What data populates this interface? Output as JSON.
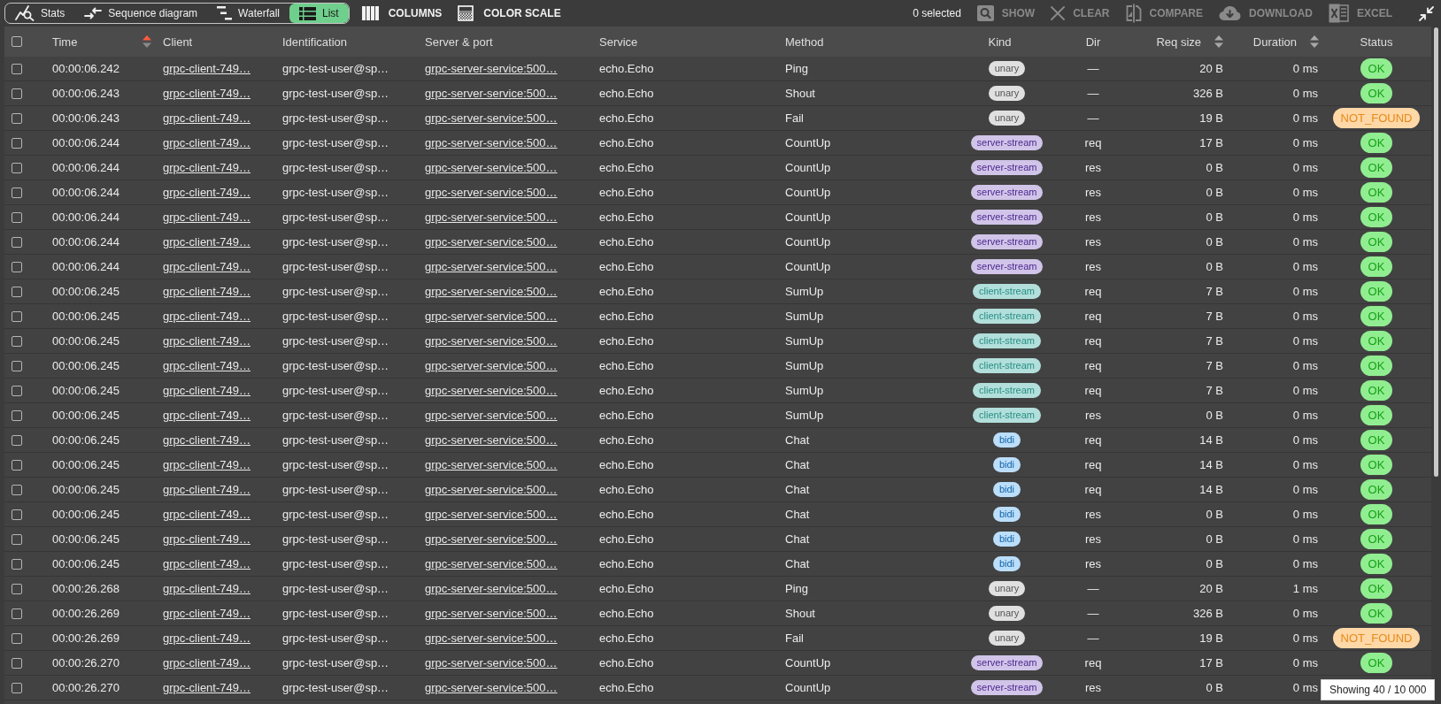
{
  "toolbar": {
    "views": [
      {
        "kind": "stats",
        "label": "Stats",
        "selected": false
      },
      {
        "kind": "sequence",
        "label": "Sequence diagram",
        "selected": false
      },
      {
        "kind": "waterfall",
        "label": "Waterfall",
        "selected": false
      },
      {
        "kind": "list",
        "label": "List",
        "selected": true
      }
    ],
    "tools": [
      {
        "kind": "columns",
        "label": "COLUMNS"
      },
      {
        "kind": "color_scale",
        "label": "COLOR SCALE"
      }
    ],
    "selection": "0 selected",
    "actions": [
      {
        "kind": "show",
        "label": "SHOW",
        "disabled": true
      },
      {
        "kind": "clear",
        "label": "CLEAR",
        "disabled": true
      },
      {
        "kind": "compare",
        "label": "COMPARE",
        "disabled": true
      },
      {
        "kind": "download",
        "label": "DOWNLOAD",
        "disabled": true
      },
      {
        "kind": "excel",
        "label": "EXCEL",
        "disabled": true
      }
    ]
  },
  "table": {
    "select_all": {
      "checked": false
    },
    "columns": [
      {
        "label": "Time",
        "sorted": true
      },
      {
        "label": "Client"
      },
      {
        "label": "Identification"
      },
      {
        "label": "Server & port"
      },
      {
        "label": "Service"
      },
      {
        "label": "Method"
      },
      {
        "label": "Kind"
      },
      {
        "label": "Dir"
      },
      {
        "label": "Req size",
        "sorted": false
      },
      {
        "label": "Duration",
        "sorted": false
      },
      {
        "label": "Status"
      }
    ],
    "rows": [
      {
        "selected": false,
        "time": "00:00:06.242",
        "client": "grpc-client-749…",
        "identification": "grpc-test-user@sp…",
        "server": "grpc-server-service:500…",
        "service": "echo.Echo",
        "method": "Ping",
        "kind": {
          "label": "unary",
          "color": "#e0e0e0"
        },
        "dir": "—",
        "req_size": "20 B",
        "duration": "0 ms",
        "status": {
          "label": "OK",
          "color": "#90ee90"
        }
      },
      {
        "selected": false,
        "time": "00:00:06.243",
        "client": "grpc-client-749…",
        "identification": "grpc-test-user@sp…",
        "server": "grpc-server-service:500…",
        "service": "echo.Echo",
        "method": "Shout",
        "kind": {
          "label": "unary",
          "color": "#e0e0e0"
        },
        "dir": "—",
        "req_size": "326 B",
        "duration": "0 ms",
        "status": {
          "label": "OK",
          "color": "#90ee90"
        }
      },
      {
        "selected": false,
        "time": "00:00:06.243",
        "client": "grpc-client-749…",
        "identification": "grpc-test-user@sp…",
        "server": "grpc-server-service:500…",
        "service": "echo.Echo",
        "method": "Fail",
        "kind": {
          "label": "unary",
          "color": "#e0e0e0"
        },
        "dir": "—",
        "req_size": "19 B",
        "duration": "0 ms",
        "status": {
          "label": "NOT_FOUND",
          "color": "#ffd8a8"
        }
      },
      {
        "selected": false,
        "time": "00:00:06.244",
        "client": "grpc-client-749…",
        "identification": "grpc-test-user@sp…",
        "server": "grpc-server-service:500…",
        "service": "echo.Echo",
        "method": "CountUp",
        "kind": {
          "label": "server-stream",
          "color": "#d1c4e9"
        },
        "dir": "req",
        "req_size": "17 B",
        "duration": "0 ms",
        "status": {
          "label": "OK",
          "color": "#90ee90"
        }
      },
      {
        "selected": false,
        "time": "00:00:06.244",
        "client": "grpc-client-749…",
        "identification": "grpc-test-user@sp…",
        "server": "grpc-server-service:500…",
        "service": "echo.Echo",
        "method": "CountUp",
        "kind": {
          "label": "server-stream",
          "color": "#d1c4e9"
        },
        "dir": "res",
        "req_size": "0 B",
        "duration": "0 ms",
        "status": {
          "label": "OK",
          "color": "#90ee90"
        }
      },
      {
        "selected": false,
        "time": "00:00:06.244",
        "client": "grpc-client-749…",
        "identification": "grpc-test-user@sp…",
        "server": "grpc-server-service:500…",
        "service": "echo.Echo",
        "method": "CountUp",
        "kind": {
          "label": "server-stream",
          "color": "#d1c4e9"
        },
        "dir": "res",
        "req_size": "0 B",
        "duration": "0 ms",
        "status": {
          "label": "OK",
          "color": "#90ee90"
        }
      },
      {
        "selected": false,
        "time": "00:00:06.244",
        "client": "grpc-client-749…",
        "identification": "grpc-test-user@sp…",
        "server": "grpc-server-service:500…",
        "service": "echo.Echo",
        "method": "CountUp",
        "kind": {
          "label": "server-stream",
          "color": "#d1c4e9"
        },
        "dir": "res",
        "req_size": "0 B",
        "duration": "0 ms",
        "status": {
          "label": "OK",
          "color": "#90ee90"
        }
      },
      {
        "selected": false,
        "time": "00:00:06.244",
        "client": "grpc-client-749…",
        "identification": "grpc-test-user@sp…",
        "server": "grpc-server-service:500…",
        "service": "echo.Echo",
        "method": "CountUp",
        "kind": {
          "label": "server-stream",
          "color": "#d1c4e9"
        },
        "dir": "res",
        "req_size": "0 B",
        "duration": "0 ms",
        "status": {
          "label": "OK",
          "color": "#90ee90"
        }
      },
      {
        "selected": false,
        "time": "00:00:06.244",
        "client": "grpc-client-749…",
        "identification": "grpc-test-user@sp…",
        "server": "grpc-server-service:500…",
        "service": "echo.Echo",
        "method": "CountUp",
        "kind": {
          "label": "server-stream",
          "color": "#d1c4e9"
        },
        "dir": "res",
        "req_size": "0 B",
        "duration": "0 ms",
        "status": {
          "label": "OK",
          "color": "#90ee90"
        }
      },
      {
        "selected": false,
        "time": "00:00:06.245",
        "client": "grpc-client-749…",
        "identification": "grpc-test-user@sp…",
        "server": "grpc-server-service:500…",
        "service": "echo.Echo",
        "method": "SumUp",
        "kind": {
          "label": "client-stream",
          "color": "#b2dfdb"
        },
        "dir": "req",
        "req_size": "7 B",
        "duration": "0 ms",
        "status": {
          "label": "OK",
          "color": "#90ee90"
        }
      },
      {
        "selected": false,
        "time": "00:00:06.245",
        "client": "grpc-client-749…",
        "identification": "grpc-test-user@sp…",
        "server": "grpc-server-service:500…",
        "service": "echo.Echo",
        "method": "SumUp",
        "kind": {
          "label": "client-stream",
          "color": "#b2dfdb"
        },
        "dir": "req",
        "req_size": "7 B",
        "duration": "0 ms",
        "status": {
          "label": "OK",
          "color": "#90ee90"
        }
      },
      {
        "selected": false,
        "time": "00:00:06.245",
        "client": "grpc-client-749…",
        "identification": "grpc-test-user@sp…",
        "server": "grpc-server-service:500…",
        "service": "echo.Echo",
        "method": "SumUp",
        "kind": {
          "label": "client-stream",
          "color": "#b2dfdb"
        },
        "dir": "req",
        "req_size": "7 B",
        "duration": "0 ms",
        "status": {
          "label": "OK",
          "color": "#90ee90"
        }
      },
      {
        "selected": false,
        "time": "00:00:06.245",
        "client": "grpc-client-749…",
        "identification": "grpc-test-user@sp…",
        "server": "grpc-server-service:500…",
        "service": "echo.Echo",
        "method": "SumUp",
        "kind": {
          "label": "client-stream",
          "color": "#b2dfdb"
        },
        "dir": "req",
        "req_size": "7 B",
        "duration": "0 ms",
        "status": {
          "label": "OK",
          "color": "#90ee90"
        }
      },
      {
        "selected": false,
        "time": "00:00:06.245",
        "client": "grpc-client-749…",
        "identification": "grpc-test-user@sp…",
        "server": "grpc-server-service:500…",
        "service": "echo.Echo",
        "method": "SumUp",
        "kind": {
          "label": "client-stream",
          "color": "#b2dfdb"
        },
        "dir": "req",
        "req_size": "7 B",
        "duration": "0 ms",
        "status": {
          "label": "OK",
          "color": "#90ee90"
        }
      },
      {
        "selected": false,
        "time": "00:00:06.245",
        "client": "grpc-client-749…",
        "identification": "grpc-test-user@sp…",
        "server": "grpc-server-service:500…",
        "service": "echo.Echo",
        "method": "SumUp",
        "kind": {
          "label": "client-stream",
          "color": "#b2dfdb"
        },
        "dir": "res",
        "req_size": "0 B",
        "duration": "0 ms",
        "status": {
          "label": "OK",
          "color": "#90ee90"
        }
      },
      {
        "selected": false,
        "time": "00:00:06.245",
        "client": "grpc-client-749…",
        "identification": "grpc-test-user@sp…",
        "server": "grpc-server-service:500…",
        "service": "echo.Echo",
        "method": "Chat",
        "kind": {
          "label": "bidi",
          "color": "#bbdefb"
        },
        "dir": "req",
        "req_size": "14 B",
        "duration": "0 ms",
        "status": {
          "label": "OK",
          "color": "#90ee90"
        }
      },
      {
        "selected": false,
        "time": "00:00:06.245",
        "client": "grpc-client-749…",
        "identification": "grpc-test-user@sp…",
        "server": "grpc-server-service:500…",
        "service": "echo.Echo",
        "method": "Chat",
        "kind": {
          "label": "bidi",
          "color": "#bbdefb"
        },
        "dir": "req",
        "req_size": "14 B",
        "duration": "0 ms",
        "status": {
          "label": "OK",
          "color": "#90ee90"
        }
      },
      {
        "selected": false,
        "time": "00:00:06.245",
        "client": "grpc-client-749…",
        "identification": "grpc-test-user@sp…",
        "server": "grpc-server-service:500…",
        "service": "echo.Echo",
        "method": "Chat",
        "kind": {
          "label": "bidi",
          "color": "#bbdefb"
        },
        "dir": "req",
        "req_size": "14 B",
        "duration": "0 ms",
        "status": {
          "label": "OK",
          "color": "#90ee90"
        }
      },
      {
        "selected": false,
        "time": "00:00:06.245",
        "client": "grpc-client-749…",
        "identification": "grpc-test-user@sp…",
        "server": "grpc-server-service:500…",
        "service": "echo.Echo",
        "method": "Chat",
        "kind": {
          "label": "bidi",
          "color": "#bbdefb"
        },
        "dir": "res",
        "req_size": "0 B",
        "duration": "0 ms",
        "status": {
          "label": "OK",
          "color": "#90ee90"
        }
      },
      {
        "selected": false,
        "time": "00:00:06.245",
        "client": "grpc-client-749…",
        "identification": "grpc-test-user@sp…",
        "server": "grpc-server-service:500…",
        "service": "echo.Echo",
        "method": "Chat",
        "kind": {
          "label": "bidi",
          "color": "#bbdefb"
        },
        "dir": "res",
        "req_size": "0 B",
        "duration": "0 ms",
        "status": {
          "label": "OK",
          "color": "#90ee90"
        }
      },
      {
        "selected": false,
        "time": "00:00:06.245",
        "client": "grpc-client-749…",
        "identification": "grpc-test-user@sp…",
        "server": "grpc-server-service:500…",
        "service": "echo.Echo",
        "method": "Chat",
        "kind": {
          "label": "bidi",
          "color": "#bbdefb"
        },
        "dir": "res",
        "req_size": "0 B",
        "duration": "0 ms",
        "status": {
          "label": "OK",
          "color": "#90ee90"
        }
      },
      {
        "selected": false,
        "time": "00:00:26.268",
        "client": "grpc-client-749…",
        "identification": "grpc-test-user@sp…",
        "server": "grpc-server-service:500…",
        "service": "echo.Echo",
        "method": "Ping",
        "kind": {
          "label": "unary",
          "color": "#e0e0e0"
        },
        "dir": "—",
        "req_size": "20 B",
        "duration": "1 ms",
        "status": {
          "label": "OK",
          "color": "#90ee90"
        }
      },
      {
        "selected": false,
        "time": "00:00:26.269",
        "client": "grpc-client-749…",
        "identification": "grpc-test-user@sp…",
        "server": "grpc-server-service:500…",
        "service": "echo.Echo",
        "method": "Shout",
        "kind": {
          "label": "unary",
          "color": "#e0e0e0"
        },
        "dir": "—",
        "req_size": "326 B",
        "duration": "0 ms",
        "status": {
          "label": "OK",
          "color": "#90ee90"
        }
      },
      {
        "selected": false,
        "time": "00:00:26.269",
        "client": "grpc-client-749…",
        "identification": "grpc-test-user@sp…",
        "server": "grpc-server-service:500…",
        "service": "echo.Echo",
        "method": "Fail",
        "kind": {
          "label": "unary",
          "color": "#e0e0e0"
        },
        "dir": "—",
        "req_size": "19 B",
        "duration": "0 ms",
        "status": {
          "label": "NOT_FOUND",
          "color": "#ffd8a8"
        }
      },
      {
        "selected": false,
        "time": "00:00:26.270",
        "client": "grpc-client-749…",
        "identification": "grpc-test-user@sp…",
        "server": "grpc-server-service:500…",
        "service": "echo.Echo",
        "method": "CountUp",
        "kind": {
          "label": "server-stream",
          "color": "#d1c4e9"
        },
        "dir": "req",
        "req_size": "17 B",
        "duration": "0 ms",
        "status": {
          "label": "OK",
          "color": "#90ee90"
        }
      },
      {
        "selected": false,
        "time": "00:00:26.270",
        "client": "grpc-client-749…",
        "identification": "grpc-test-user@sp…",
        "server": "grpc-server-service:500…",
        "service": "echo.Echo",
        "method": "CountUp",
        "kind": {
          "label": "server-stream",
          "color": "#d1c4e9"
        },
        "dir": "res",
        "req_size": "0 B",
        "duration": "0 ms"
      }
    ]
  },
  "tooltip": "Showing 40 / 10 000"
}
